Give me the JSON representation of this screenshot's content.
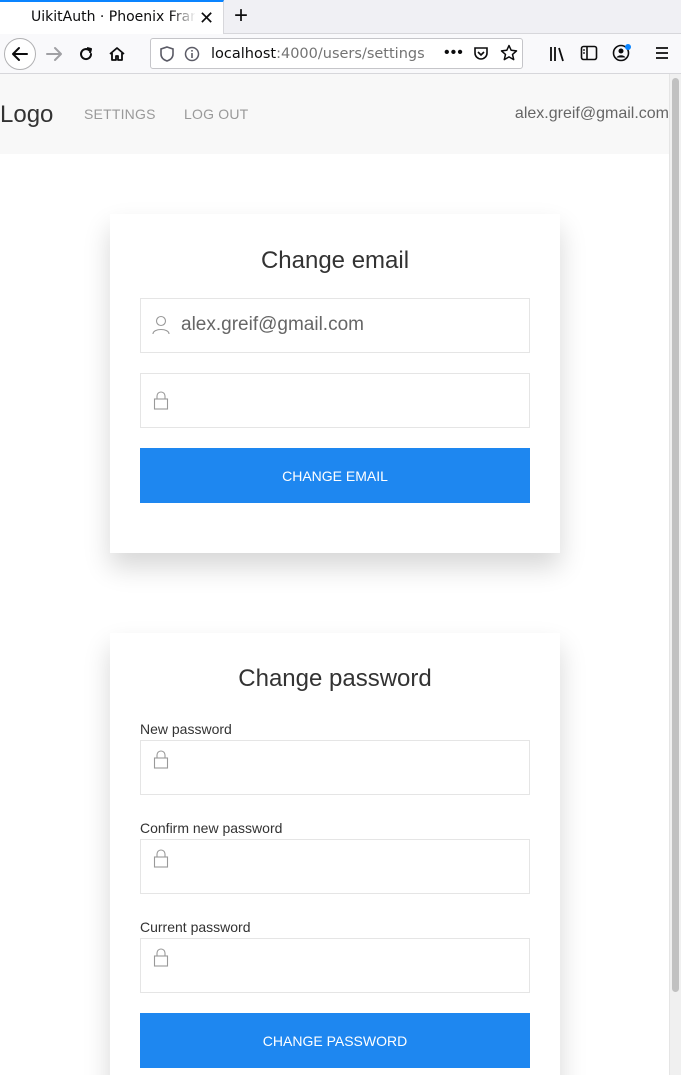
{
  "browser": {
    "tab_title": "UikitAuth · Phoenix Framework",
    "url_host": "localhost",
    "url_rest": ":4000/users/settings"
  },
  "header": {
    "logo": "Logo",
    "nav": [
      "Settings",
      "Log out"
    ],
    "user_email": "alex.greif@gmail.com"
  },
  "change_email": {
    "title": "Change email",
    "email_value": "alex.greif@gmail.com",
    "password_value": "",
    "button": "Change email"
  },
  "change_password": {
    "title": "Change password",
    "new_password_label": "New password",
    "confirm_password_label": "Confirm new password",
    "current_password_label": "Current password",
    "button": "Change password"
  },
  "colors": {
    "primary": "#1e87f0",
    "browser_accent": "#0a84ff"
  }
}
